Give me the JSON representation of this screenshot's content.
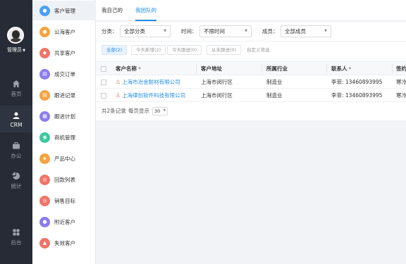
{
  "user": {
    "name": "管理员"
  },
  "rail": {
    "items": [
      {
        "label": "首页",
        "icon": "home-icon"
      },
      {
        "label": "CRM",
        "icon": "crm-icon"
      },
      {
        "label": "办公",
        "icon": "briefcase-icon"
      },
      {
        "label": "统计",
        "icon": "pie-chart-icon"
      },
      {
        "label": "后台",
        "icon": "grid-icon"
      }
    ]
  },
  "menu": {
    "items": [
      {
        "label": "客户管理",
        "icon": "user-icon",
        "color": "#4a9ff5"
      },
      {
        "label": "公海客户",
        "icon": "person-icon",
        "color": "#f4a340"
      },
      {
        "label": "共享客户",
        "icon": "share-icon",
        "color": "#f27367"
      },
      {
        "label": "成交订单",
        "icon": "order-icon",
        "color": "#8b7cf0"
      },
      {
        "label": "跟进记录",
        "icon": "record-icon",
        "color": "#f4a340"
      },
      {
        "label": "跟进计划",
        "icon": "plan-icon",
        "color": "#8b7cf0"
      },
      {
        "label": "商机管理",
        "icon": "opportunity-icon",
        "color": "#3cc8a1"
      },
      {
        "label": "产品中心",
        "icon": "product-icon",
        "color": "#f4a340"
      },
      {
        "label": "回款列表",
        "icon": "payment-icon",
        "color": "#f27367"
      },
      {
        "label": "销售目标",
        "icon": "target-icon",
        "color": "#f27367"
      },
      {
        "label": "附近客户",
        "icon": "location-icon",
        "color": "#8b7cf0"
      },
      {
        "label": "失效客户",
        "icon": "warning-icon",
        "color": "#f27367"
      }
    ]
  },
  "tabs": [
    {
      "label": "我自己的"
    },
    {
      "label": "我团队的"
    }
  ],
  "filters": {
    "category_label": "分类：",
    "category_value": "全部分类",
    "time_label": "时间：",
    "time_value": "不限时间",
    "member_label": "成员：",
    "member_value": "全部成员"
  },
  "chips": [
    {
      "label": "全部(2)"
    },
    {
      "label": "今天新增(2)"
    },
    {
      "label": "今天跟进(0)"
    },
    {
      "label": "从未跟进(0)"
    }
  ],
  "custom_filter": "自定义筛选",
  "table": {
    "headers": [
      "客户名称",
      "客户地址",
      "所属行业",
      "联系人",
      "签约"
    ],
    "rows": [
      {
        "name": "上海市冶金耐材有限公司",
        "address": "上海市闵行区",
        "industry": "制造业",
        "contact": "李菲: 13460893995",
        "sign": "寒冷"
      },
      {
        "name": "上海律创软件科技有限公司",
        "address": "上海市闵行区",
        "industry": "制造业",
        "contact": "李菲: 13460893995",
        "sign": "寒冷"
      }
    ]
  },
  "pager": {
    "total_text": "共2条记录",
    "per_page_label": "每页显示",
    "per_page_value": "30"
  },
  "colors": {
    "accent": "#1f8ceb",
    "rail_bg": "#262b36"
  }
}
